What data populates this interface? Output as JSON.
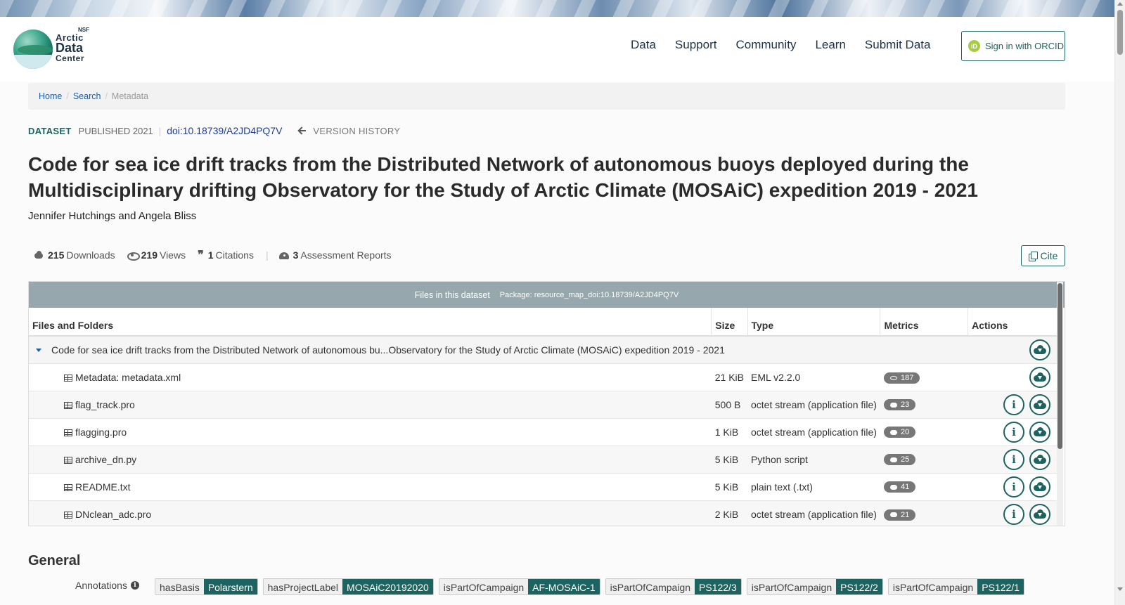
{
  "header": {
    "logo": {
      "nsf": "NSF",
      "line1": "Arctic",
      "line2": "Data",
      "line3": "Center"
    },
    "nav": [
      "Data",
      "Support",
      "Community",
      "Learn",
      "Submit Data"
    ],
    "orcid": {
      "icon": "iD",
      "label": "Sign in with ORCID"
    }
  },
  "breadcrumb": {
    "home": "Home",
    "search": "Search",
    "current": "Metadata",
    "sep": "/"
  },
  "meta": {
    "type": "DATASET",
    "published": "PUBLISHED 2021",
    "sep": "|",
    "doi": "doi:10.18739/A2JD4PQ7V",
    "version_history": "VERSION HISTORY"
  },
  "title": "Code for sea ice drift tracks from the Distributed Network of autonomous buoys deployed during the Multidisciplinary drifting Observatory for the Study of Arctic Climate (MOSAiC) expedition 2019 - 2021",
  "authors": "Jennifer Hutchings and Angela Bliss",
  "metrics": {
    "downloads": {
      "count": "215",
      "label": "Downloads"
    },
    "views": {
      "count": "219",
      "label": "Views"
    },
    "citations": {
      "count": "1",
      "label": "Citations"
    },
    "sep": "|",
    "assessments": {
      "count": "3",
      "label": "Assessment Reports"
    }
  },
  "cite_label": "Cite",
  "files": {
    "header": "Files in this dataset",
    "package": "Package: resource_map_doi:10.18739/A2JD4PQ7V",
    "columns": [
      "Files and Folders",
      "Size",
      "Type",
      "Metrics",
      "Actions"
    ],
    "folder": "Code for sea ice drift tracks from the Distributed Network of autonomous bu...Observatory for the Study of Arctic Climate (MOSAiC) expedition 2019 - 2021",
    "rows": [
      {
        "name": "Metadata: metadata.xml",
        "size": "21 KiB",
        "type": "EML v2.2.0",
        "metric": "187",
        "metric_icon": "eye-icon"
      },
      {
        "name": "flag_track.pro",
        "size": "500 B",
        "type": "octet stream (application file)",
        "metric": "23",
        "metric_icon": "cloud-download-icon"
      },
      {
        "name": "flagging.pro",
        "size": "1 KiB",
        "type": "octet stream (application file)",
        "metric": "20",
        "metric_icon": "cloud-download-icon"
      },
      {
        "name": "archive_dn.py",
        "size": "5 KiB",
        "type": "Python script",
        "metric": "25",
        "metric_icon": "cloud-download-icon"
      },
      {
        "name": "README.txt",
        "size": "5 KiB",
        "type": "plain text (.txt)",
        "metric": "41",
        "metric_icon": "cloud-download-icon"
      },
      {
        "name": "DNclean_adc.pro",
        "size": "2 KiB",
        "type": "octet stream (application file)",
        "metric": "21",
        "metric_icon": "cloud-download-icon"
      }
    ]
  },
  "general": {
    "heading": "General",
    "annotations_label": "Annotations",
    "annotations": [
      {
        "key": "hasBasis",
        "value": "Polarstern"
      },
      {
        "key": "hasProjectLabel",
        "value": "MOSAiC20192020"
      },
      {
        "key": "isPartOfCampaign",
        "value": "AF-MOSAiC-1"
      },
      {
        "key": "isPartOfCampaign",
        "value": "PS122/3"
      },
      {
        "key": "isPartOfCampaign",
        "value": "PS122/2"
      },
      {
        "key": "isPartOfCampaign",
        "value": "PS122/1"
      }
    ]
  },
  "colors": {
    "accent": "#1d6460",
    "link": "#1d5fa6",
    "files_header": "#97a7ae"
  }
}
